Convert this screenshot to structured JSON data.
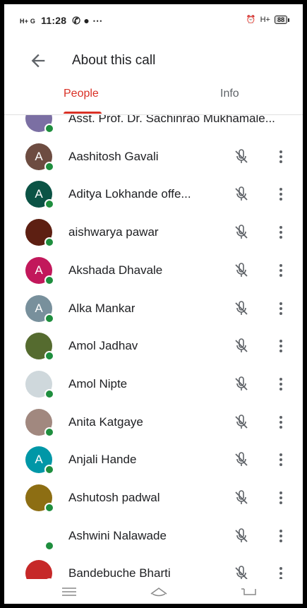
{
  "status": {
    "network_left": "H+ G",
    "time": "11:28",
    "right_network": "H+",
    "battery": "88"
  },
  "header": {
    "title": "About this call"
  },
  "tabs": [
    {
      "label": "People"
    },
    {
      "label": "Info"
    }
  ],
  "participants": [
    {
      "name": "Asst. Prof. Dr. Sachinrao Mukhamale...",
      "initial": "",
      "color": "#7b6fa3"
    },
    {
      "name": "Aashitosh Gavali",
      "initial": "A",
      "color": "#6d4c41"
    },
    {
      "name": "Aditya Lokhande offe...",
      "initial": "A",
      "color": "#0b5345"
    },
    {
      "name": "aishwarya pawar",
      "initial": "",
      "color": "#5d1f12"
    },
    {
      "name": "Akshada Dhavale",
      "initial": "A",
      "color": "#c2185b"
    },
    {
      "name": "Alka Mankar",
      "initial": "A",
      "color": "#78909c"
    },
    {
      "name": "Amol Jadhav",
      "initial": "",
      "color": "#556b2f"
    },
    {
      "name": "Amol Nipte",
      "initial": "",
      "color": "#cfd8dc"
    },
    {
      "name": "Anita Katgaye",
      "initial": "",
      "color": "#a1887f"
    },
    {
      "name": "Anjali Hande",
      "initial": "A",
      "color": "#0097a7"
    },
    {
      "name": "Ashutosh padwal",
      "initial": "",
      "color": "#8d6e13"
    },
    {
      "name": "Ashwini Nalawade",
      "initial": "",
      "color": "#ffffff"
    },
    {
      "name": "Bandebuche Bharti",
      "initial": "",
      "color": "#c62828"
    }
  ],
  "colors": {
    "accent": "#d93025",
    "online": "#1e8e3e"
  },
  "icons": {
    "mic": "mic-off-icon",
    "more": "more-vert-icon"
  }
}
